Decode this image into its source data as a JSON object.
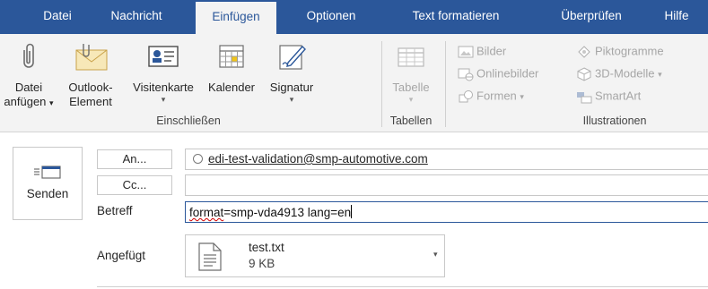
{
  "tabs": [
    {
      "label": "Datei",
      "active": false
    },
    {
      "label": "Nachricht",
      "active": false
    },
    {
      "label": "Einfügen",
      "active": true
    },
    {
      "label": "Optionen",
      "active": false
    },
    {
      "label": "Text formatieren",
      "active": false
    },
    {
      "label": "Überprüfen",
      "active": false
    },
    {
      "label": "Hilfe",
      "active": false
    }
  ],
  "ribbon": {
    "include": {
      "attach_file_line1": "Datei",
      "attach_file_line2": "anfügen",
      "outlook_item_line1": "Outlook-",
      "outlook_item_line2": "Element",
      "business_card": "Visitenkarte",
      "calendar": "Kalender",
      "signature": "Signatur",
      "group_label": "Einschließen"
    },
    "tables": {
      "table": "Tabelle",
      "group_label": "Tabellen"
    },
    "illustrations": {
      "pictures": "Bilder",
      "online_pictures": "Onlinebilder",
      "shapes": "Formen",
      "icons": "Piktogramme",
      "models_3d": "3D-Modelle",
      "smartart": "SmartArt",
      "group_label": "Illustrationen"
    }
  },
  "compose": {
    "send_label": "Senden",
    "to_button": "An...",
    "cc_button": "Cc...",
    "to_recipient": "edi-test-validation@smp-automotive.com",
    "cc_value": "",
    "subject_label": "Betreff",
    "subject_word1": "format",
    "subject_rest": "=smp-vda4913 lang=en",
    "attached_label": "Angefügt",
    "attachment_name": "test.txt",
    "attachment_size": "9 KB"
  },
  "colors": {
    "accent": "#2b579a",
    "ribbon_bg": "#f3f3f3",
    "disabled_text": "#a6a6a6"
  }
}
